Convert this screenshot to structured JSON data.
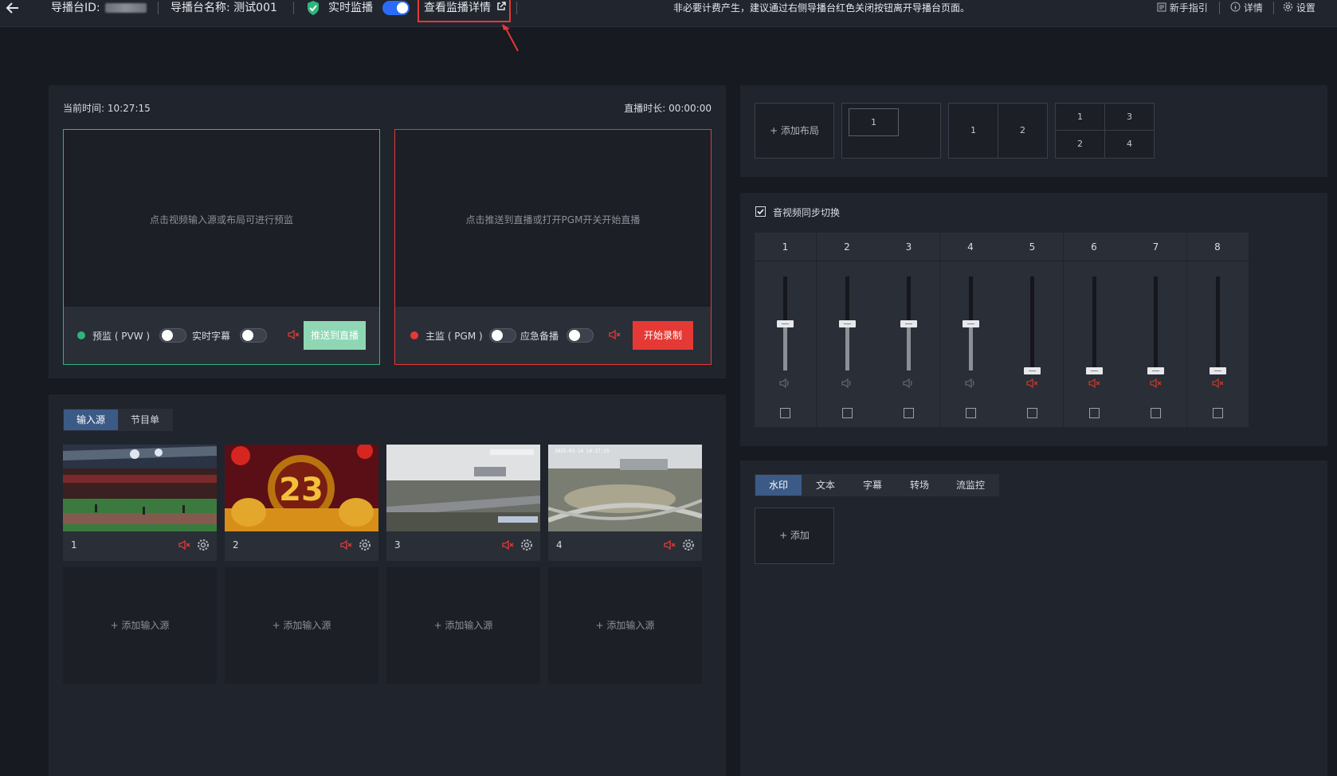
{
  "topbar": {
    "back_icon": "arrow-left-icon",
    "id_label": "导播台ID:",
    "name_label": "导播台名称: 测试001",
    "monitor_label": "实时监播",
    "monitor_on": true,
    "detail_link": "查看监播详情",
    "notice": "非必要计费产生，建议通过右侧导播台红色关闭按钮离开导播台页面。",
    "guide": "新手指引",
    "details": "详情",
    "settings": "设置"
  },
  "preview": {
    "current_time_label": "当前时间: 10:27:15",
    "duration_label": "直播时长: 00:00:00",
    "pvw_hint": "点击视频输入源或布局可进行预监",
    "pgm_hint": "点击推送到直播或打开PGM开关开始直播",
    "pvw_label": "预监 ( PVW )",
    "subtitle_label": "实时字幕",
    "push_button": "推送到直播",
    "pgm_label": "主监 ( PGM )",
    "backup_label": "应急备播",
    "record_button": "开始录制",
    "colors": {
      "pvw": "#2fb57a",
      "pgm": "#e53935"
    }
  },
  "sources": {
    "tabs": [
      "输入源",
      "节目单"
    ],
    "active_tab": "输入源",
    "items": [
      {
        "num": "1"
      },
      {
        "num": "2"
      },
      {
        "num": "3"
      },
      {
        "num": "4"
      }
    ],
    "add_label": "+ 添加输入源",
    "thumb3_caption": "2025-03-14 10:27:25"
  },
  "layouts": {
    "add_label": "+ 添加布局",
    "single": "1",
    "dual": [
      "1",
      "2"
    ],
    "quad": [
      "1",
      "3",
      "2",
      "4"
    ]
  },
  "audio": {
    "sync_label": "音视频同步切换",
    "sync_checked": true,
    "channels": [
      {
        "num": "1",
        "level": 0.5,
        "muted": false
      },
      {
        "num": "2",
        "level": 0.5,
        "muted": false
      },
      {
        "num": "3",
        "level": 0.5,
        "muted": false
      },
      {
        "num": "4",
        "level": 0.5,
        "muted": false
      },
      {
        "num": "5",
        "level": 0.0,
        "muted": true
      },
      {
        "num": "6",
        "level": 0.0,
        "muted": true
      },
      {
        "num": "7",
        "level": 0.0,
        "muted": true
      },
      {
        "num": "8",
        "level": 0.0,
        "muted": true
      }
    ]
  },
  "overlay": {
    "tabs": [
      "水印",
      "文本",
      "字幕",
      "转场",
      "流监控"
    ],
    "active_tab": "水印",
    "add_label": "+ 添加"
  }
}
